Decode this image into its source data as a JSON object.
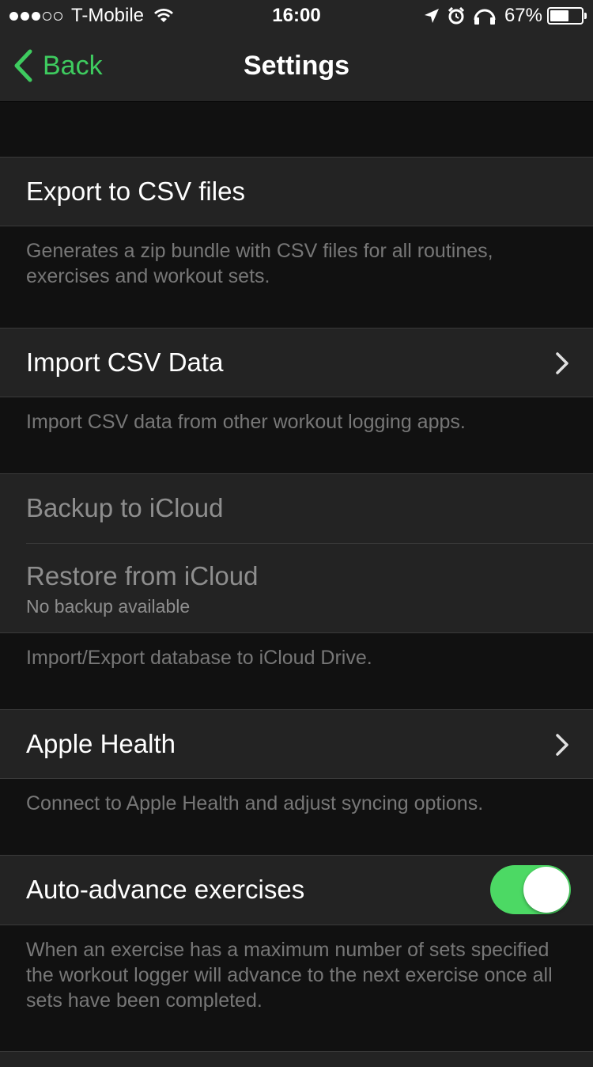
{
  "status_bar": {
    "carrier": "T-Mobile",
    "time": "16:00",
    "battery": "67%",
    "battery_level": 0.67,
    "signal_bars_filled": 3,
    "signal_bars_total": 5
  },
  "nav": {
    "back_label": "Back",
    "title": "Settings"
  },
  "sections": {
    "export": {
      "label": "Export to CSV files",
      "footer": "Generates a zip bundle with CSV files for all routines, exercises and workout sets."
    },
    "import": {
      "label": "Import CSV Data",
      "footer": "Import CSV data from other workout logging apps."
    },
    "icloud": {
      "backup_label": "Backup to iCloud",
      "restore_label": "Restore from iCloud",
      "restore_sub": "No backup available",
      "footer": "Import/Export database to iCloud Drive."
    },
    "health": {
      "label": "Apple Health",
      "footer": "Connect to Apple Health and adjust syncing options."
    },
    "auto_advance": {
      "label": "Auto-advance exercises",
      "enabled": true,
      "footer": "When an exercise has a maximum number of sets specified the workout logger will advance to the next exercise once all sets have been completed."
    }
  },
  "colors": {
    "accent": "#3ecb5f",
    "toggle_on": "#4cd964",
    "background": "#111111",
    "cell": "#232323"
  }
}
